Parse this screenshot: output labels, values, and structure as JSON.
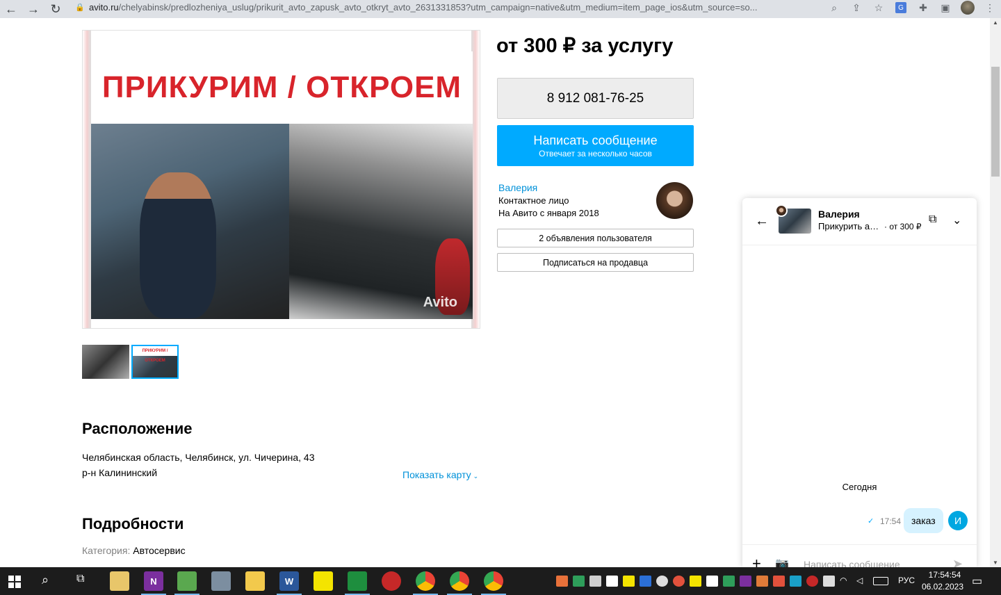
{
  "browser": {
    "url_host": "avito.ru",
    "url_rest": "/chelyabinsk/predlozheniya_uslug/prikurit_avto_zapusk_avto_otkryt_avto_2631331853?utm_campaign=native&utm_medium=item_page_ios&utm_source=so..."
  },
  "listing": {
    "price": "от 300 ₽ за услугу",
    "photo_banner": "ПРИКУРИМ / ОТКРОЕМ",
    "photo_watermark": "Avito",
    "thumb_banner": "ПРИКУРИМ / ОТКРОЕМ",
    "phone": "8 912 081-76-25",
    "message_button": "Написать сообщение",
    "message_subtext": "Отвечает за несколько часов"
  },
  "seller": {
    "name": "Валерия",
    "role": "Контактное лицо",
    "since": "На Авито с января 2018",
    "listings_button": "2 объявления пользователя",
    "subscribe_button": "Подписаться на продавца"
  },
  "location": {
    "title": "Расположение",
    "address": "Челябинская область, Челябинск, ул. Чичерина, 43",
    "district": "р-н Калининский",
    "show_map": "Показать карту"
  },
  "details": {
    "title": "Подробности",
    "category_label": "Категория:",
    "category_value": "Автосервис"
  },
  "chat": {
    "name": "Валерия",
    "item": "Прикурить автомобиль",
    "price": "· от 300 ₽",
    "date_divider": "Сегодня",
    "message_text": "заказ",
    "message_time": "17:54",
    "user_initial": "И",
    "input_placeholder": "Написать сообщение"
  },
  "taskbar": {
    "lang": "РУС",
    "time": "17:54:54",
    "date": "06.02.2023"
  },
  "colors": {
    "accent": "#00aaff",
    "link": "#0091d9",
    "banner_red": "#d8242b",
    "bubble": "#d6f2ff"
  }
}
